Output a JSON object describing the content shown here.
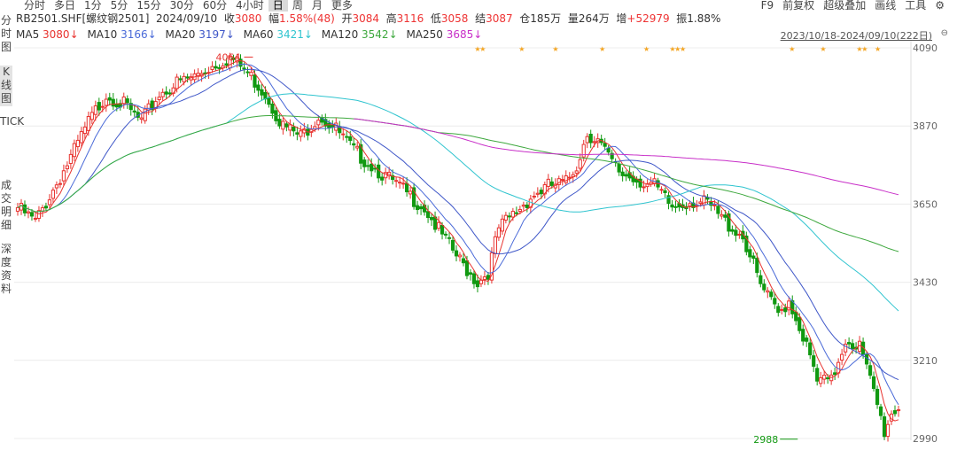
{
  "periods": [
    "分时",
    "多日",
    "1分",
    "5分",
    "15分",
    "30分",
    "60分",
    "4小时",
    "日",
    "周",
    "月",
    "更多"
  ],
  "active_period": "日",
  "tools": [
    "F9",
    "前复权",
    "超级叠加",
    "画线",
    "工具"
  ],
  "sidebar": [
    "分时图",
    "K线图",
    "TICK",
    "成交明细",
    "深度资料"
  ],
  "quote": {
    "symbol": "RB2501.SHF[螺纹钢2501]",
    "date": "2024/09/10",
    "close_label": "收",
    "close": "3080",
    "change_label": "幅",
    "change": "1.58%(48)",
    "open_label": "开",
    "open": "3084",
    "high_label": "高",
    "high": "3116",
    "low_label": "低",
    "low": "3058",
    "settle_label": "结",
    "settle": "3087",
    "oi_label": "仓",
    "oi": "185万",
    "vol_label": "量",
    "vol": "264万",
    "inc_label": "增",
    "inc": "+52979",
    "amp_label": "振",
    "amp": "1.88%"
  },
  "ma_legend": [
    {
      "name": "MA5",
      "value": "3080↓",
      "color": "#e8332f"
    },
    {
      "name": "MA10",
      "value": "3166↓",
      "color": "#4a6ad8"
    },
    {
      "name": "MA20",
      "value": "3197↓",
      "color": "#3f57c8"
    },
    {
      "name": "MA60",
      "value": "3421↓",
      "color": "#2fc4cf"
    },
    {
      "name": "MA120",
      "value": "3542↓",
      "color": "#3ea83e"
    },
    {
      "name": "MA250",
      "value": "3685↓",
      "color": "#c82fc8"
    }
  ],
  "range_label": "2023/10/18-2024/09/10(222日)",
  "colors": {
    "up": "#e8332f",
    "down": "#119911",
    "star": "#f5a623"
  },
  "chart_data": {
    "type": "candlestick",
    "y_ticks": [
      4090,
      3870,
      3650,
      3430,
      3210,
      2990
    ],
    "ylim": [
      2985,
      4100
    ],
    "grid": true,
    "annotations": [
      {
        "label": "4064",
        "value": 4064,
        "index": 67,
        "color": "#e8332f"
      },
      {
        "label": "2988",
        "value": 2988,
        "index": 220,
        "color": "#119911"
      }
    ],
    "star_indices": [
      177,
      179,
      194,
      207,
      225,
      242,
      252,
      254,
      256,
      298,
      310,
      324,
      326,
      331
    ],
    "anchors": [
      [
        0,
        3640
      ],
      [
        5,
        3600
      ],
      [
        10,
        3690
      ],
      [
        15,
        3780
      ],
      [
        20,
        3880
      ],
      [
        25,
        3960
      ],
      [
        30,
        3930
      ],
      [
        35,
        3880
      ],
      [
        40,
        3960
      ],
      [
        45,
        3990
      ],
      [
        50,
        4010
      ],
      [
        55,
        4040
      ],
      [
        60,
        4064
      ],
      [
        65,
        4020
      ],
      [
        70,
        3960
      ],
      [
        75,
        3870
      ],
      [
        80,
        3840
      ],
      [
        85,
        3900
      ],
      [
        90,
        3860
      ],
      [
        95,
        3800
      ],
      [
        100,
        3760
      ],
      [
        105,
        3720
      ],
      [
        110,
        3680
      ],
      [
        115,
        3640
      ],
      [
        120,
        3560
      ],
      [
        125,
        3490
      ],
      [
        130,
        3430
      ],
      [
        133,
        3460
      ],
      [
        136,
        3580
      ],
      [
        140,
        3620
      ],
      [
        145,
        3670
      ],
      [
        150,
        3700
      ],
      [
        155,
        3710
      ],
      [
        158,
        3760
      ],
      [
        161,
        3850
      ],
      [
        164,
        3830
      ],
      [
        167,
        3780
      ],
      [
        170,
        3740
      ],
      [
        175,
        3720
      ],
      [
        180,
        3700
      ],
      [
        185,
        3640
      ],
      [
        190,
        3660
      ],
      [
        195,
        3650
      ],
      [
        200,
        3600
      ],
      [
        205,
        3560
      ],
      [
        210,
        3420
      ],
      [
        215,
        3340
      ],
      [
        218,
        3380
      ],
      [
        222,
        3280
      ],
      [
        226,
        3150
      ],
      [
        230,
        3150
      ],
      [
        234,
        3270
      ],
      [
        238,
        3250
      ],
      [
        242,
        3120
      ],
      [
        245,
        3010
      ],
      [
        247,
        3060
      ],
      [
        249,
        3080
      ]
    ]
  }
}
